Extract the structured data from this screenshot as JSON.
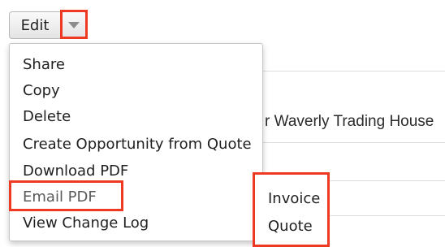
{
  "toolbar": {
    "edit_label": "Edit",
    "dropdown_icon": "chevron-down-icon"
  },
  "background": {
    "record_name_fragment": "r Waverly Trading House"
  },
  "menu": {
    "items": [
      {
        "label": "Share"
      },
      {
        "label": "Copy"
      },
      {
        "label": "Delete"
      },
      {
        "label": "Create Opportunity from Quote"
      },
      {
        "label": "Download PDF"
      },
      {
        "label": "Email PDF"
      },
      {
        "label": "View Change Log"
      }
    ]
  },
  "submenu": {
    "items": [
      {
        "label": "Invoice"
      },
      {
        "label": "Quote"
      }
    ]
  },
  "colors": {
    "highlight": "#ee3a22"
  }
}
